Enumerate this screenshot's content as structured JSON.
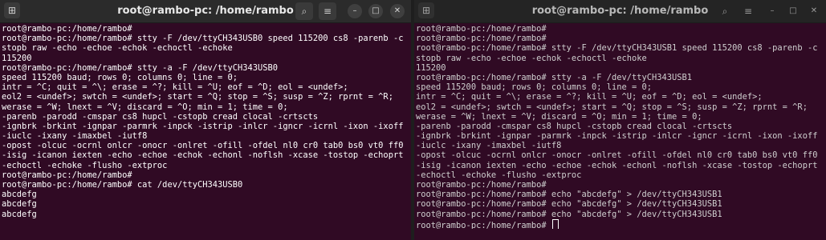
{
  "left": {
    "title": "root@rambo-pc: /home/rambo",
    "lines": [
      "root@rambo-pc:/home/rambo#",
      "root@rambo-pc:/home/rambo# stty -F /dev/ttyCH343USB0 speed 115200 cs8 -parenb -c",
      "stopb raw -echo -echoe -echok -echoctl -echoke",
      "115200",
      "root@rambo-pc:/home/rambo# stty -a -F /dev/ttyCH343USB0",
      "speed 115200 baud; rows 0; columns 0; line = 0;",
      "intr = ^C; quit = ^\\; erase = ^?; kill = ^U; eof = ^D; eol = <undef>;",
      "eol2 = <undef>; swtch = <undef>; start = ^Q; stop = ^S; susp = ^Z; rprnt = ^R;",
      "werase = ^W; lnext = ^V; discard = ^O; min = 1; time = 0;",
      "-parenb -parodd -cmspar cs8 hupcl -cstopb cread clocal -crtscts",
      "-ignbrk -brkint -ignpar -parmrk -inpck -istrip -inlcr -igncr -icrnl -ixon -ixoff",
      "-iuclc -ixany -imaxbel -iutf8",
      "-opost -olcuc -ocrnl onlcr -onocr -onlret -ofill -ofdel nl0 cr0 tab0 bs0 vt0 ff0",
      "-isig -icanon iexten -echo -echoe -echok -echonl -noflsh -xcase -tostop -echoprt",
      "-echoctl -echoke -flusho -extproc",
      "root@rambo-pc:/home/rambo#",
      "root@rambo-pc:/home/rambo# cat /dev/ttyCH343USB0",
      "abcdefg",
      "abcdefg",
      "abcdefg"
    ]
  },
  "right": {
    "title": "root@rambo-pc: /home/rambo",
    "lines": [
      "root@rambo-pc:/home/rambo#",
      "root@rambo-pc:/home/rambo#",
      "root@rambo-pc:/home/rambo# stty -F /dev/ttyCH343USB1 speed 115200 cs8 -parenb -c",
      "stopb raw -echo -echoe -echok -echoctl -echoke",
      "115200",
      "root@rambo-pc:/home/rambo# stty -a -F /dev/ttyCH343USB1",
      "speed 115200 baud; rows 0; columns 0; line = 0;",
      "intr = ^C; quit = ^\\; erase = ^?; kill = ^U; eof = ^D; eol = <undef>;",
      "eol2 = <undef>; swtch = <undef>; start = ^Q; stop = ^S; susp = ^Z; rprnt = ^R;",
      "werase = ^W; lnext = ^V; discard = ^O; min = 1; time = 0;",
      "-parenb -parodd -cmspar cs8 hupcl -cstopb cread clocal -crtscts",
      "-ignbrk -brkint -ignpar -parmrk -inpck -istrip -inlcr -igncr -icrnl -ixon -ixoff",
      "-iuclc -ixany -imaxbel -iutf8",
      "-opost -olcuc -ocrnl onlcr -onocr -onlret -ofill -ofdel nl0 cr0 tab0 bs0 vt0 ff0",
      "-isig -icanon iexten -echo -echoe -echok -echonl -noflsh -xcase -tostop -echoprt",
      "-echoctl -echoke -flusho -extproc",
      "root@rambo-pc:/home/rambo#",
      "root@rambo-pc:/home/rambo# echo \"abcdefg\" > /dev/ttyCH343USB1",
      "root@rambo-pc:/home/rambo# echo \"abcdefg\" > /dev/ttyCH343USB1",
      "root@rambo-pc:/home/rambo# echo \"abcdefg\" > /dev/ttyCH343USB1",
      "root@rambo-pc:/home/rambo# "
    ]
  },
  "icons": {
    "new_tab": "new-tab-icon",
    "search": "search-icon",
    "menu": "hamburger-menu-icon",
    "minimize": "minimize-icon",
    "maximize": "maximize-icon",
    "close": "close-icon"
  },
  "colors": {
    "terminal_bg": "#300a24",
    "titlebar_active": "#2b2b2b",
    "titlebar_inactive": "#242424",
    "text": "#ffffff"
  }
}
